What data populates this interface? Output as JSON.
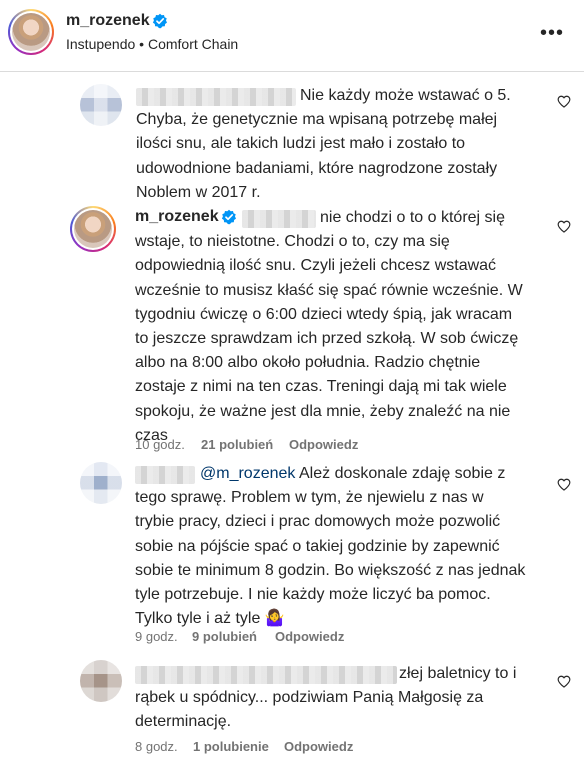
{
  "header": {
    "username": "m_rozenek",
    "subtitle": "Instupendo • Comfort Chain",
    "more_glyph": "•••",
    "verified_icon": "verified-badge-icon",
    "more_icon": "more-options-icon"
  },
  "comments": [
    {
      "text": "Nie każdy może wstawać o 5.\nChyba, że genetycznie ma wpisaną potrzebę małej\nilości snu, ale takich ludzi jest mało i zostało to\nudowodnione badaniami, które nagrodzone zostały\nNoblem w 2017 r."
    },
    {
      "username": "m_rozenek",
      "text": "nie chodzi o to o której się\nwstaje, to nieistotne. Chodzi o to, czy ma się\nodpowiednią ilość snu. Czyli jeżeli chcesz wstawać\nwcześnie to musisz kłaść się spać równie wcześnie. W\ntygodniu ćwiczę o 6:00 dzieci wtedy śpią, jak wracam\nto jeszcze sprawdzam ich przed szkołą. W sob ćwiczę\nalbo na 8:00 albo około południa. Radzio chętnie\nzostaje z nimi na ten czas. Treningi dają mi tak wiele\nspokoju, że ważne jest dla mnie, żeby znaleźć na nie\nczas",
      "time": "10 godz.",
      "likes": "21 polubień",
      "reply": "Odpowiedz"
    },
    {
      "mention": "@m_rozenek",
      "text": "Ależ doskonale zdaję sobie z\ntego sprawę. Problem w tym, że njewielu z nas w\ntrybie pracy, dzieci i prac domowych może pozwolić\nsobie na pójście spać o takiej godzinie by zapewnić\nsobie te minimum 8 godzin. Bo większość z nas jednak\ntyle potrzebuje. I nie każdy może liczyć ba pomoc.\nTylko tyle i aż tyle 🤷‍♀️",
      "time": "9 godz.",
      "likes": "9 polubień",
      "reply": "Odpowiedz"
    },
    {
      "text": "złej baletnicy to i\nrąbek u spódnicy... podziwiam Panią Małgosię za\ndeterminację.",
      "time": "8 godz.",
      "likes": "1 polubienie",
      "reply": "Odpowiedz"
    }
  ],
  "icons": {
    "like": "heart-icon"
  },
  "colors": {
    "text": "#262626",
    "meta": "#737373",
    "verified": "#0095f6",
    "mention": "#00376b"
  }
}
